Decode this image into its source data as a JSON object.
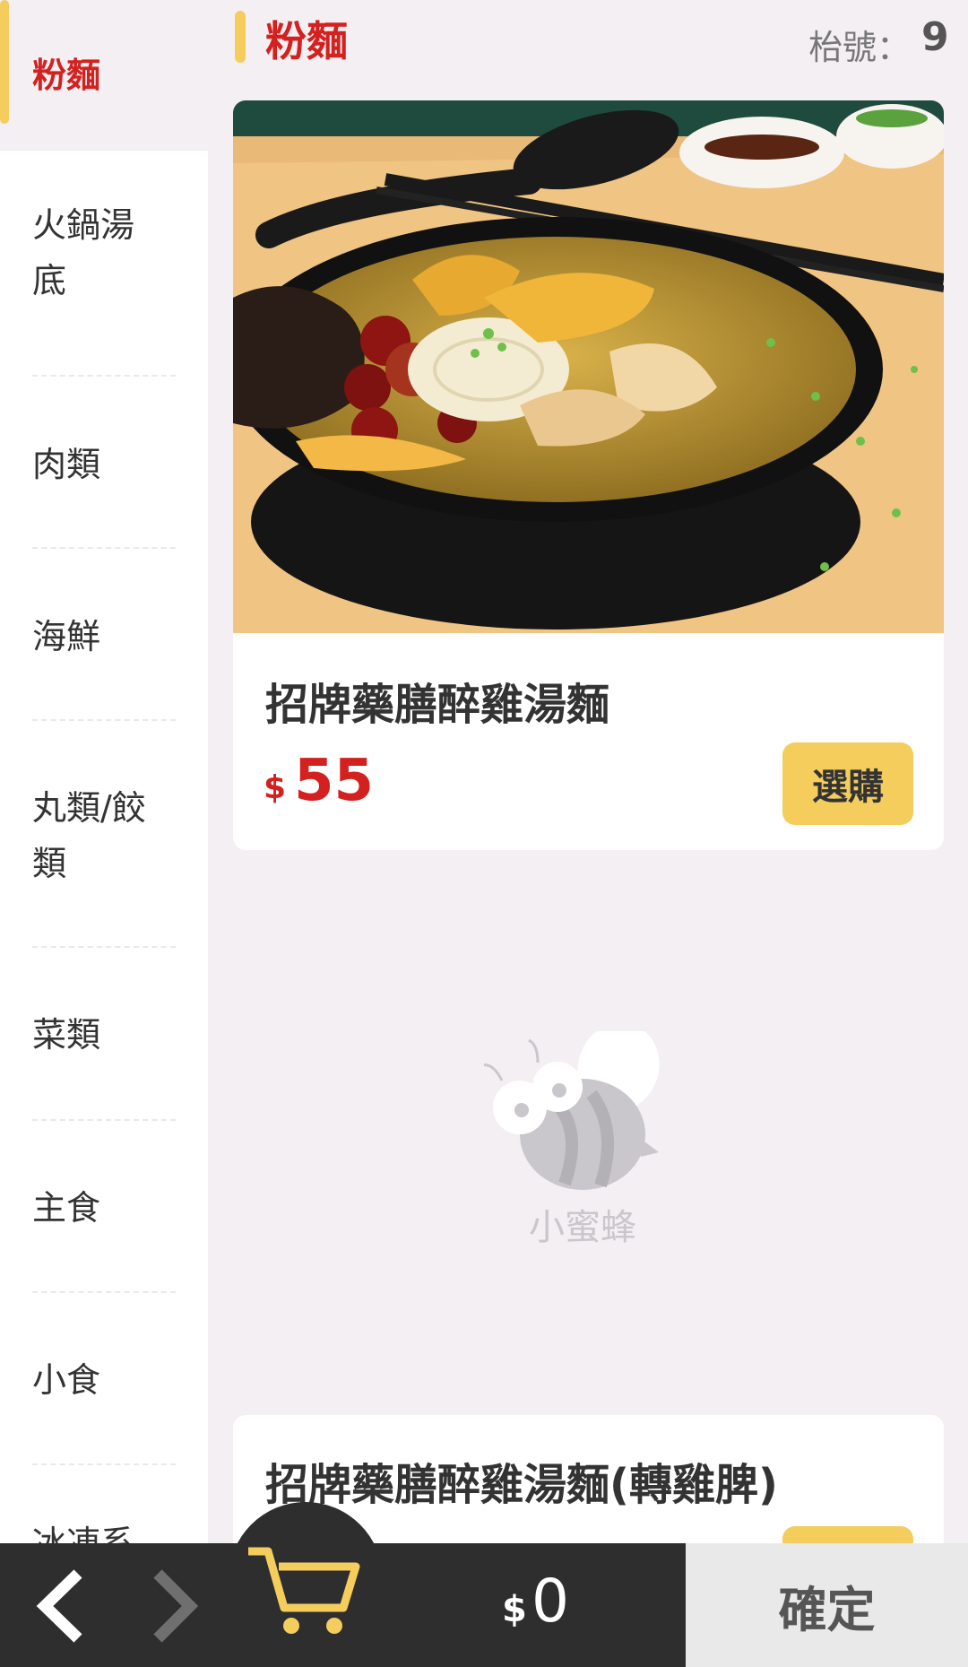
{
  "sidebar": {
    "active": "粉麵",
    "items": [
      {
        "label": "火鍋湯\n底"
      },
      {
        "label": "肉類"
      },
      {
        "label": "海鮮"
      },
      {
        "label": "丸類/餃\n類"
      },
      {
        "label": "菜類"
      },
      {
        "label": "主食"
      },
      {
        "label": "小食"
      },
      {
        "label": "冰凍系"
      }
    ]
  },
  "header": {
    "title": "粉麵",
    "table_label": "枱號：",
    "table_number": "9"
  },
  "products": [
    {
      "name": "招牌藥膳醉雞湯麵",
      "currency": "$",
      "price": "55",
      "button": "選購"
    },
    {
      "name": "招牌藥膳醉雞湯麵(轉雞脾)",
      "currency": "$",
      "price": "",
      "button": ""
    }
  ],
  "placeholder": {
    "logo_text": "小蜜蜂"
  },
  "bottom_bar": {
    "currency": "$",
    "total": "0",
    "confirm_label": "確定"
  },
  "colors": {
    "accent_red": "#d3211f",
    "accent_yellow": "#f4cd5d",
    "background": "#f4eff2",
    "dark_bar": "#2e2e2e"
  }
}
